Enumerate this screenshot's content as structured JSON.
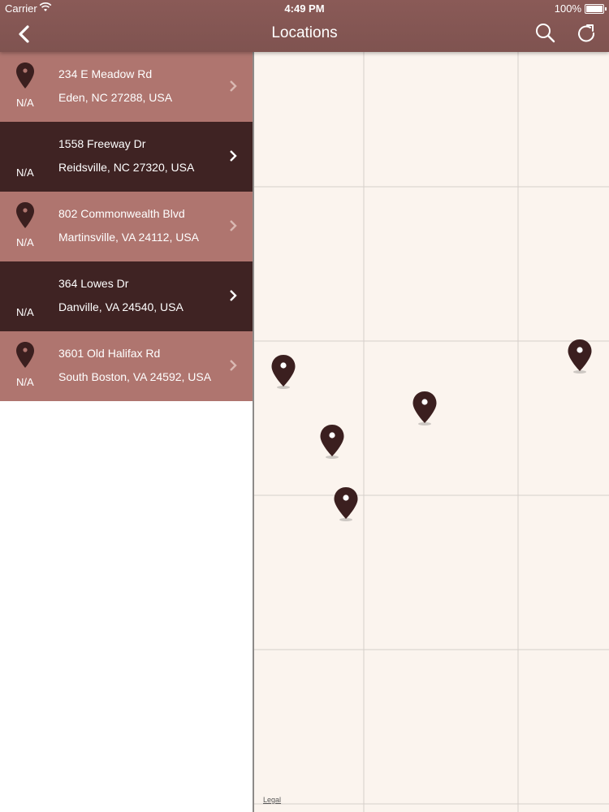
{
  "status_bar": {
    "carrier": "Carrier",
    "time": "4:49 PM",
    "battery": "100%"
  },
  "nav": {
    "title": "Locations",
    "icons": [
      "back-icon",
      "search-icon",
      "refresh-icon"
    ]
  },
  "locations": [
    {
      "line1": "234 E Meadow Rd",
      "line2": "Eden, NC 27288, USA",
      "distance": "N/A",
      "style": "light",
      "has_pin": true
    },
    {
      "line1": "1558 Freeway Dr",
      "line2": "Reidsville, NC 27320, USA",
      "distance": "N/A",
      "style": "dark",
      "has_pin": false
    },
    {
      "line1": "802 Commonwealth Blvd",
      "line2": "Martinsville, VA 24112, USA",
      "distance": "N/A",
      "style": "light",
      "has_pin": true
    },
    {
      "line1": "364 Lowes Dr",
      "line2": "Danville, VA 24540, USA",
      "distance": "N/A",
      "style": "dark",
      "has_pin": false
    },
    {
      "line1": "3601 Old Halifax Rd",
      "line2": "South Boston, VA 24592, USA",
      "distance": "N/A",
      "style": "light",
      "has_pin": true
    }
  ],
  "map": {
    "legal": "Legal",
    "pin_count": 5
  },
  "colors": {
    "header": "#7f5350",
    "row_light": "#af756f",
    "row_dark": "#3f2323",
    "pin": "#3b1f1f",
    "map_bg": "#fbf4ee",
    "map_grid": "#d6cfca"
  }
}
